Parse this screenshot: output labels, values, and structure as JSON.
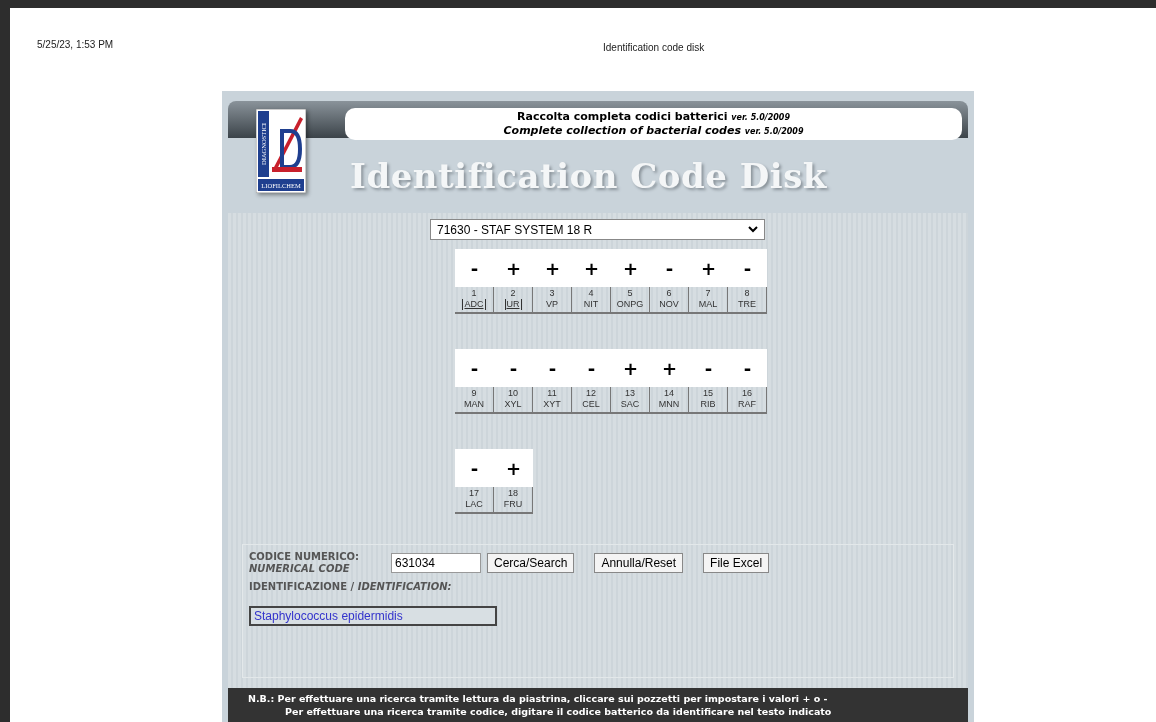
{
  "print_header": {
    "date": "5/25/23, 1:53 PM",
    "title": "Identification code disk"
  },
  "banner": {
    "logo_texts": [
      "DIAGNOSTICI",
      "LIOFILCHEM"
    ],
    "subtitle_it": "Raccolta completa codici batterici",
    "version_it": "ver. 5.0/2009",
    "subtitle_en": "Complete collection of bacterial codes",
    "version_en": "ver. 5.0/2009",
    "title": "Identification Code Disk"
  },
  "system_select": {
    "value": "71630 - STAF SYSTEM 18 R"
  },
  "test_rows": [
    [
      {
        "result": "-",
        "number": "1",
        "code": "ADC",
        "underlined": true
      },
      {
        "result": "+",
        "number": "2",
        "code": "UR",
        "underlined": true
      },
      {
        "result": "+",
        "number": "3",
        "code": "VP",
        "underlined": false
      },
      {
        "result": "+",
        "number": "4",
        "code": "NIT",
        "underlined": false
      },
      {
        "result": "+",
        "number": "5",
        "code": "ONPG",
        "underlined": false
      },
      {
        "result": "-",
        "number": "6",
        "code": "NOV",
        "underlined": false
      },
      {
        "result": "+",
        "number": "7",
        "code": "MAL",
        "underlined": false
      },
      {
        "result": "-",
        "number": "8",
        "code": "TRE",
        "underlined": false
      }
    ],
    [
      {
        "result": "-",
        "number": "9",
        "code": "MAN",
        "underlined": false
      },
      {
        "result": "-",
        "number": "10",
        "code": "XYL",
        "underlined": false
      },
      {
        "result": "-",
        "number": "11",
        "code": "XYT",
        "underlined": false
      },
      {
        "result": "-",
        "number": "12",
        "code": "CEL",
        "underlined": false
      },
      {
        "result": "+",
        "number": "13",
        "code": "SAC",
        "underlined": false
      },
      {
        "result": "+",
        "number": "14",
        "code": "MNN",
        "underlined": false
      },
      {
        "result": "-",
        "number": "15",
        "code": "RIB",
        "underlined": false
      },
      {
        "result": "-",
        "number": "16",
        "code": "RAF",
        "underlined": false
      }
    ],
    [
      {
        "result": "-",
        "number": "17",
        "code": "LAC",
        "underlined": false
      },
      {
        "result": "+",
        "number": "18",
        "code": "FRU",
        "underlined": false
      }
    ]
  ],
  "code_form": {
    "label_it": "CODICE NUMERICO:",
    "label_en": "NUMERICAL CODE",
    "value": "631034",
    "buttons": [
      "Cerca/Search",
      "Annulla/Reset",
      "File Excel"
    ]
  },
  "identification": {
    "label_it": "IDENTIFICAZIONE /",
    "label_en": "IDENTIFICATION:",
    "value": "Staphylococcus epidermidis"
  },
  "note": {
    "lines": [
      "N.B.: Per effettuare una ricerca tramite lettura  da piastrina, cliccare sui pozzetti  per impostare i valori + o -",
      "Per effettuare una ricerca tramite codice, digitare il codice batterico da identificare nel testo indicato"
    ]
  }
}
